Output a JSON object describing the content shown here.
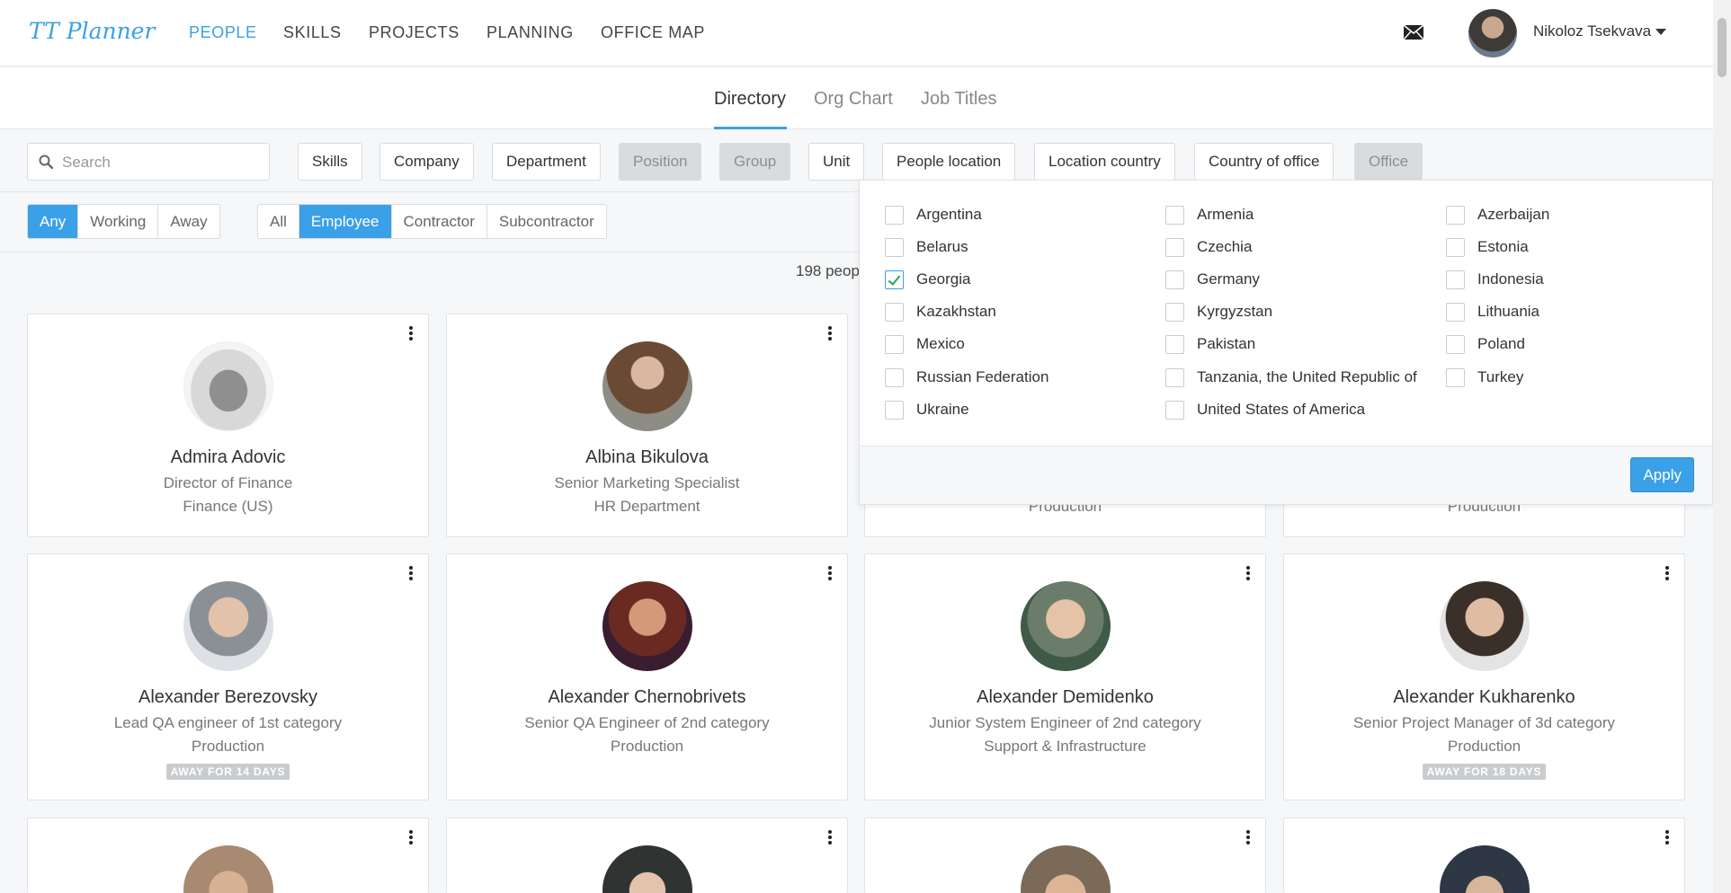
{
  "app": {
    "logo": "TT Planner"
  },
  "nav": {
    "items": [
      {
        "label": "PEOPLE",
        "active": true
      },
      {
        "label": "SKILLS",
        "active": false
      },
      {
        "label": "PROJECTS",
        "active": false
      },
      {
        "label": "PLANNING",
        "active": false
      },
      {
        "label": "OFFICE MAP",
        "active": false
      }
    ],
    "mail_icon": "mail-icon",
    "user_name": "Nikoloz Tsekvava"
  },
  "subtabs": [
    {
      "label": "Directory",
      "active": true
    },
    {
      "label": "Org Chart",
      "active": false
    },
    {
      "label": "Job Titles",
      "active": false
    }
  ],
  "filters": {
    "search_placeholder": "Search",
    "buttons": [
      {
        "label": "Skills",
        "disabled": false
      },
      {
        "label": "Company",
        "disabled": false
      },
      {
        "label": "Department",
        "disabled": false
      },
      {
        "label": "Position",
        "disabled": true
      },
      {
        "label": "Group",
        "disabled": true
      },
      {
        "label": "Unit",
        "disabled": false
      },
      {
        "label": "People location",
        "disabled": false
      },
      {
        "label": "Location country",
        "disabled": false
      },
      {
        "label": "Country of office",
        "disabled": false
      },
      {
        "label": "Office",
        "disabled": true
      }
    ],
    "status": [
      {
        "label": "Any",
        "selected": true
      },
      {
        "label": "Working",
        "selected": false
      },
      {
        "label": "Away",
        "selected": false
      }
    ],
    "type": [
      {
        "label": "All",
        "selected": false
      },
      {
        "label": "Employee",
        "selected": true
      },
      {
        "label": "Contractor",
        "selected": false
      },
      {
        "label": "Subcontractor",
        "selected": false
      }
    ]
  },
  "people_count": "198 peop",
  "country_dropdown": {
    "options": [
      {
        "label": "Argentina",
        "checked": false
      },
      {
        "label": "Armenia",
        "checked": false
      },
      {
        "label": "Azerbaijan",
        "checked": false
      },
      {
        "label": "Belarus",
        "checked": false
      },
      {
        "label": "Czechia",
        "checked": false
      },
      {
        "label": "Estonia",
        "checked": false
      },
      {
        "label": "Georgia",
        "checked": true
      },
      {
        "label": "Germany",
        "checked": false
      },
      {
        "label": "Indonesia",
        "checked": false
      },
      {
        "label": "Kazakhstan",
        "checked": false
      },
      {
        "label": "Kyrgyzstan",
        "checked": false
      },
      {
        "label": "Lithuania",
        "checked": false
      },
      {
        "label": "Mexico",
        "checked": false
      },
      {
        "label": "Pakistan",
        "checked": false
      },
      {
        "label": "Poland",
        "checked": false
      },
      {
        "label": "Russian Federation",
        "checked": false
      },
      {
        "label": "Tanzania, the United Republic of",
        "checked": false
      },
      {
        "label": "Turkey",
        "checked": false
      },
      {
        "label": "Ukraine",
        "checked": false
      },
      {
        "label": "United States of America",
        "checked": false
      }
    ],
    "apply_label": "Apply"
  },
  "people": [
    {
      "name": "Admira Adovic",
      "title": "Director of Finance",
      "department": "Finance (US)",
      "away": ""
    },
    {
      "name": "Albina Bikulova",
      "title": "Senior Marketing Specialist",
      "department": "HR Department",
      "away": ""
    },
    {
      "name": "",
      "title": "",
      "department": "Production",
      "away": ""
    },
    {
      "name": "",
      "title": "",
      "department": "Production",
      "away": ""
    },
    {
      "name": "Alexander Berezovsky",
      "title": "Lead QA engineer of 1st category",
      "department": "Production",
      "away": "AWAY FOR 14 DAYS"
    },
    {
      "name": "Alexander Chernobrivets",
      "title": "Senior QA Engineer of 2nd category",
      "department": "Production",
      "away": ""
    },
    {
      "name": "Alexander Demidenko",
      "title": "Junior System Engineer of 2nd category",
      "department": "Support & Infrastructure",
      "away": ""
    },
    {
      "name": "Alexander Kukharenko",
      "title": "Senior Project Manager of 3d category",
      "department": "Production",
      "away": "AWAY FOR 18 DAYS"
    },
    {
      "name": "",
      "title": "",
      "department": "",
      "away": ""
    },
    {
      "name": "",
      "title": "",
      "department": "",
      "away": ""
    },
    {
      "name": "",
      "title": "",
      "department": "",
      "away": ""
    },
    {
      "name": "",
      "title": "",
      "department": "",
      "away": ""
    }
  ],
  "colors": {
    "accent": "#3aa0e8",
    "check": "#2a9d55",
    "disabled_bg": "#d9dbde"
  }
}
